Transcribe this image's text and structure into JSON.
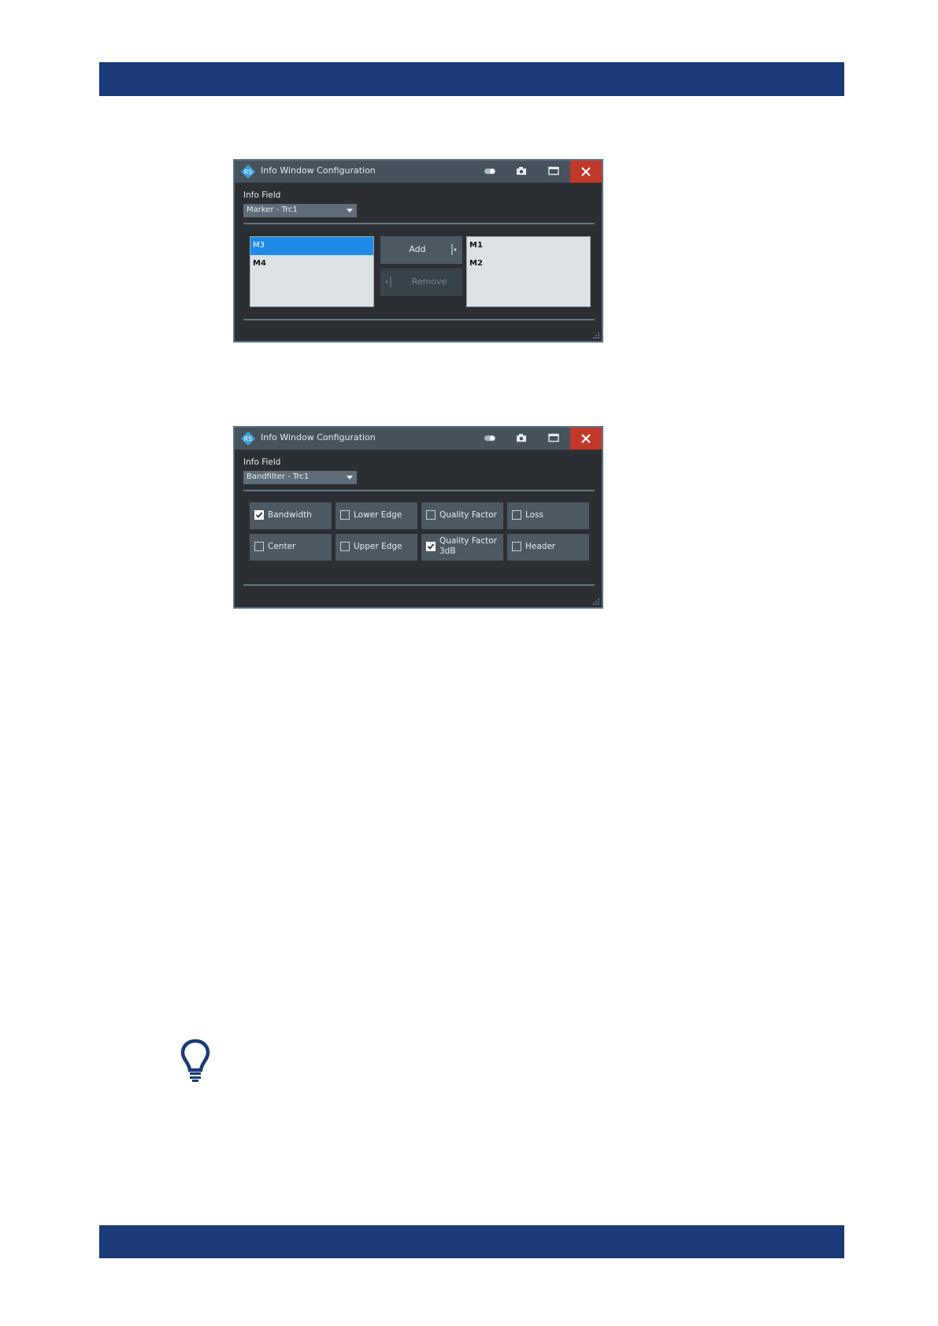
{
  "dialog1": {
    "title": "Info Window Configuration",
    "info_field_label": "Info Field",
    "info_field_value": "Marker - Trc1",
    "available_items": [
      "M3",
      "M4"
    ],
    "selected_items": [
      "M1",
      "M2"
    ],
    "add_label": "Add",
    "remove_label": "Remove"
  },
  "dialog2": {
    "title": "Info Window Configuration",
    "info_field_label": "Info Field",
    "info_field_value": "Bandfilter - Trc1",
    "options": [
      {
        "label": "Bandwidth",
        "checked": true
      },
      {
        "label": "Lower Edge",
        "checked": false
      },
      {
        "label": "Quality Factor",
        "checked": false
      },
      {
        "label": "Loss",
        "checked": false
      },
      {
        "label": "Center",
        "checked": false
      },
      {
        "label": "Upper Edge",
        "checked": false
      },
      {
        "label": "Quality Factor 3dB",
        "checked": true
      },
      {
        "label": "Header",
        "checked": false
      }
    ]
  },
  "icons": {
    "logo": "rs-logo-icon",
    "toggle": "toggle-icon",
    "screenshot": "camera-icon",
    "maximize": "maximize-icon",
    "close": "close-icon",
    "tip": "lightbulb-icon"
  },
  "colors": {
    "header_band": "#1a3a78",
    "dialog_bg": "#2b2f33",
    "titlebar": "#46525c",
    "close_button": "#c0392b",
    "selection": "#1e8be6"
  }
}
